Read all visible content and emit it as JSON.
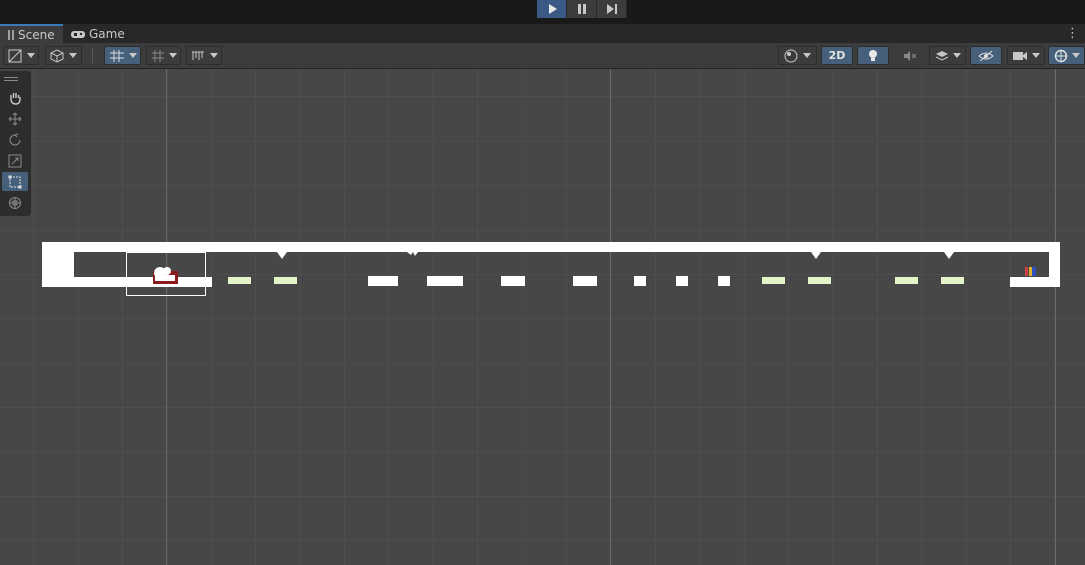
{
  "playbar": {
    "buttons": [
      {
        "name": "play-icon",
        "active": true
      },
      {
        "name": "pause-icon",
        "active": false
      },
      {
        "name": "step-icon",
        "active": false
      }
    ]
  },
  "tabs": [
    {
      "label": "Scene",
      "icon": "scene-hash-icon",
      "active": true
    },
    {
      "label": "Game",
      "icon": "gamepad-icon",
      "active": false
    }
  ],
  "toolbar": {
    "view_2d_label": "2D"
  },
  "tools": [
    {
      "name": "hand-tool-icon",
      "active": false
    },
    {
      "name": "move-tool-icon",
      "active": false
    },
    {
      "name": "rotate-tool-icon",
      "active": false
    },
    {
      "name": "scale-tool-icon",
      "active": false
    },
    {
      "name": "rect-tool-icon",
      "active": true
    },
    {
      "name": "transform-tool-icon",
      "active": false
    }
  ],
  "colors": {
    "background": "#474747",
    "toolbar": "#3c3c3c",
    "topbar": "#191919",
    "accent": "#3a5a85",
    "level_white": "#ffffff",
    "platform_light": "#e3f5c8",
    "player_red": "#8b1a1a"
  }
}
